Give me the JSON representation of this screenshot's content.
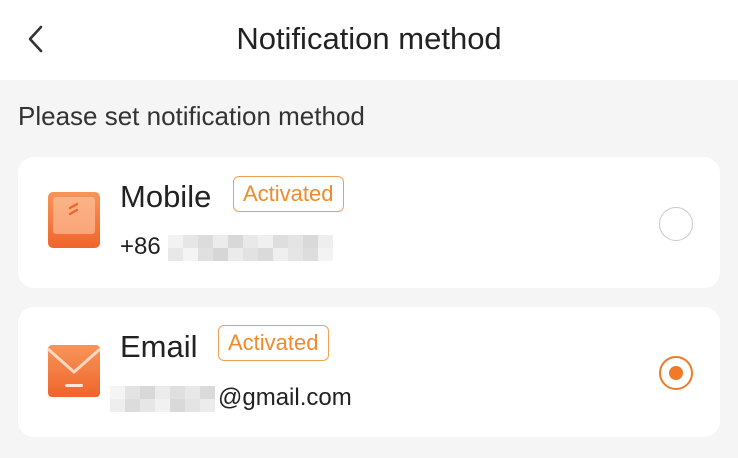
{
  "header": {
    "title": "Notification method",
    "back_icon": "chevron-left-icon"
  },
  "section_label": "Please set notification method",
  "colors": {
    "accent": "#f07a28",
    "badge_border": "#f0a055",
    "background": "#f5f5f5",
    "card": "#ffffff"
  },
  "methods": [
    {
      "title": "Mobile",
      "badge": "Activated",
      "detail_visible": "+86",
      "icon": "mobile-phone-icon",
      "selected": false
    },
    {
      "title": "Email",
      "badge": "Activated",
      "detail_visible": "@gmail.com",
      "icon": "email-envelope-icon",
      "selected": true
    }
  ]
}
